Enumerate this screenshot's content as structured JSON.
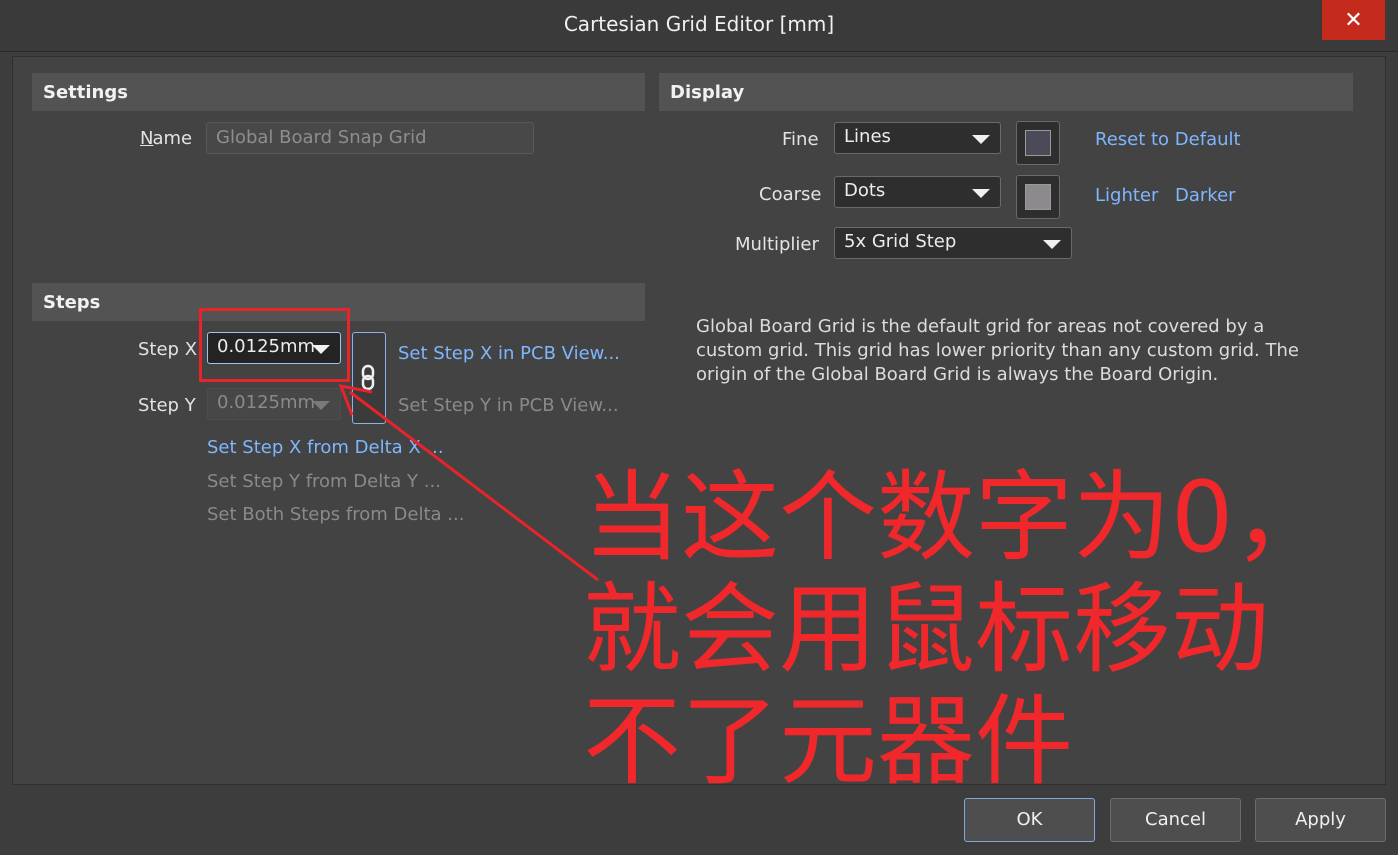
{
  "window": {
    "title": "Cartesian Grid Editor [mm]",
    "close_glyph": "✕"
  },
  "settings": {
    "header": "Settings",
    "name_label": "Name",
    "name_value": "Global Board Snap Grid"
  },
  "steps": {
    "header": "Steps",
    "step_x_label": "Step X",
    "step_x_value": "0.0125mm",
    "step_y_label": "Step Y",
    "step_y_value": "0.0125mm",
    "link_icon": "chain-link-icon",
    "set_step_x_in_view": "Set Step X in PCB View...",
    "set_step_y_in_view": "Set Step Y in PCB View...",
    "set_x_from_delta": "Set Step X from Delta X ...",
    "set_y_from_delta": "Set Step Y from Delta Y ...",
    "set_both_from_delta": "Set Both Steps from Delta ..."
  },
  "display": {
    "header": "Display",
    "fine_label": "Fine",
    "fine_value": "Lines",
    "fine_color": "#4a4a58",
    "coarse_label": "Coarse",
    "coarse_value": "Dots",
    "coarse_color": "#8c8a8d",
    "multiplier_label": "Multiplier",
    "multiplier_value": "5x Grid Step",
    "reset_link": "Reset to Default",
    "lighter_link": "Lighter",
    "darker_link": "Darker",
    "description": "Global Board Grid is the default grid for areas not covered by a custom grid. This grid has lower priority than any custom grid. The origin of the Global Board Grid is always the Board Origin."
  },
  "annotation": {
    "text": "当这个数字为0，就会用鼠标移动不了元器件",
    "color": "#f0282c"
  },
  "buttons": {
    "ok": "OK",
    "cancel": "Cancel",
    "apply": "Apply"
  }
}
